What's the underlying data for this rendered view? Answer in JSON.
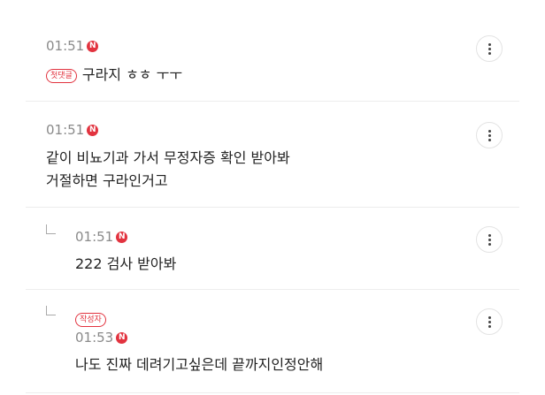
{
  "comments": [
    {
      "time": "01:51",
      "badge": "N",
      "tag": "첫댓글",
      "text": "구라지 ㅎㅎ ㅜㅜ"
    },
    {
      "time": "01:51",
      "badge": "N",
      "text_line1": "같이 비뇨기과 가서 무정자증 확인 받아봐",
      "text_line2": "거절하면 구라인거고"
    },
    {
      "time": "01:51",
      "badge": "N",
      "text": "222 검사 받아봐"
    },
    {
      "time": "01:53",
      "badge": "N",
      "tag": "작성자",
      "text": "나도 진짜 데려기고싶은데 끝까지인정안해"
    }
  ],
  "icons": {
    "more": "more-vertical-icon",
    "reply": "reply-arrow-icon",
    "new": "new-badge-icon"
  },
  "colors": {
    "accent": "#e2333f",
    "muted": "#8a8a8a",
    "divider": "#ededed"
  }
}
